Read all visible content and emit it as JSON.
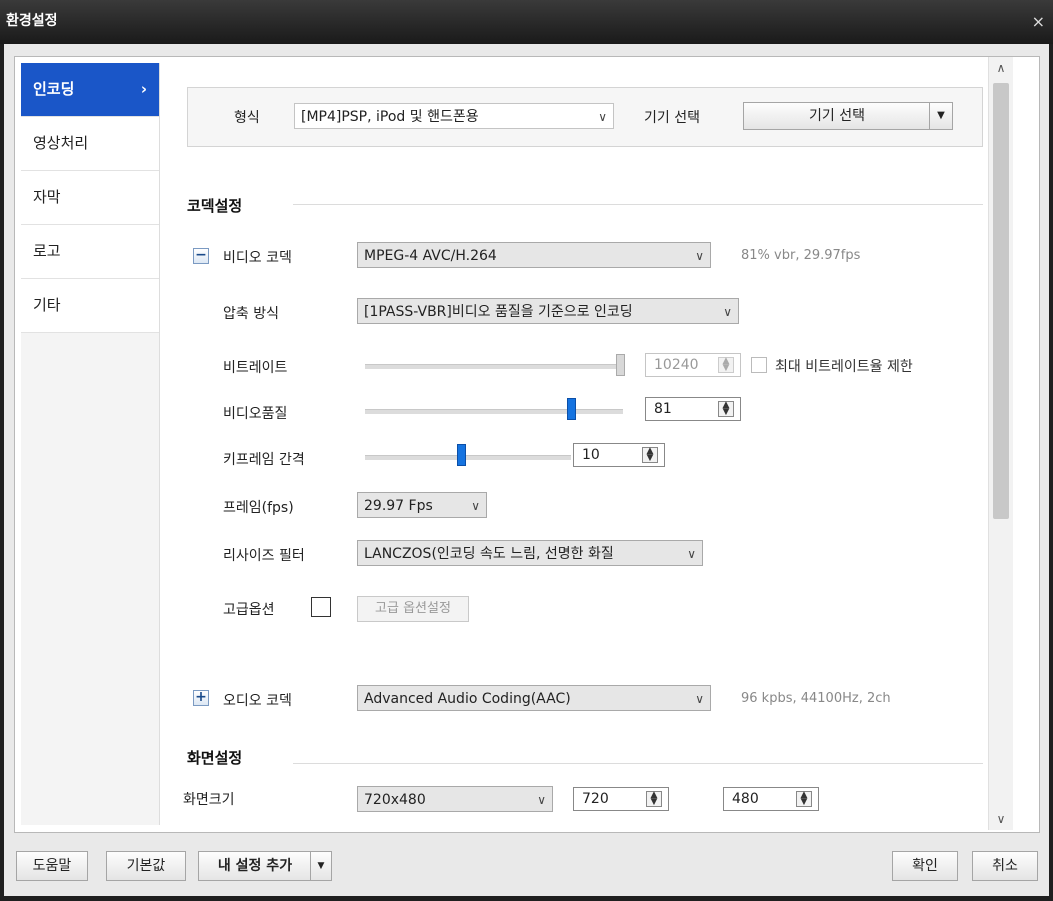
{
  "window": {
    "title": "환경설정",
    "close_glyph": "×"
  },
  "sidebar": {
    "items": [
      {
        "label": "인코딩",
        "active": true
      },
      {
        "label": "영상처리"
      },
      {
        "label": "자막"
      },
      {
        "label": "로고"
      },
      {
        "label": "기타"
      }
    ],
    "active_chevron": "›"
  },
  "format": {
    "label": "형식",
    "value": "[MP4]PSP, iPod 및 핸드폰용",
    "device_label": "기기 선택",
    "device_button": "기기 선택"
  },
  "codec_section": {
    "title": "코덱설정",
    "video": {
      "toggle": "−",
      "label": "비디오 코덱",
      "value": "MPEG-4 AVC/H.264",
      "info": "81% vbr, 29.97fps",
      "compression_label": "압축 방식",
      "compression_value": "[1PASS-VBR]비디오 품질을 기준으로 인코딩",
      "bitrate_label": "비트레이트",
      "bitrate_value": "10240",
      "max_bitrate_label": "최대 비트레이트율 제한",
      "quality_label": "비디오품질",
      "quality_value": "81",
      "keyframe_label": "키프레임 간격",
      "keyframe_value": "10",
      "fps_label": "프레임(fps)",
      "fps_value": "29.97 Fps",
      "resize_label": "리사이즈 필터",
      "resize_value": "LANCZOS(인코딩 속도 느림, 선명한 화질",
      "advanced_label": "고급옵션",
      "advanced_button": "고급 옵션설정"
    },
    "audio": {
      "toggle": "+",
      "label": "오디오 코덱",
      "value": "Advanced Audio Coding(AAC)",
      "info": "96 kpbs, 44100Hz, 2ch"
    }
  },
  "screen_section": {
    "title": "화면설정",
    "size_label": "화면크기",
    "size_value": "720x480",
    "width_value": "720",
    "height_value": "480"
  },
  "footer": {
    "help": "도움말",
    "default": "기본값",
    "add_setting": "내 설정 추가",
    "ok": "확인",
    "cancel": "취소"
  },
  "colors": {
    "accent": "#1a56c8",
    "slider_thumb": "#1573e0"
  }
}
